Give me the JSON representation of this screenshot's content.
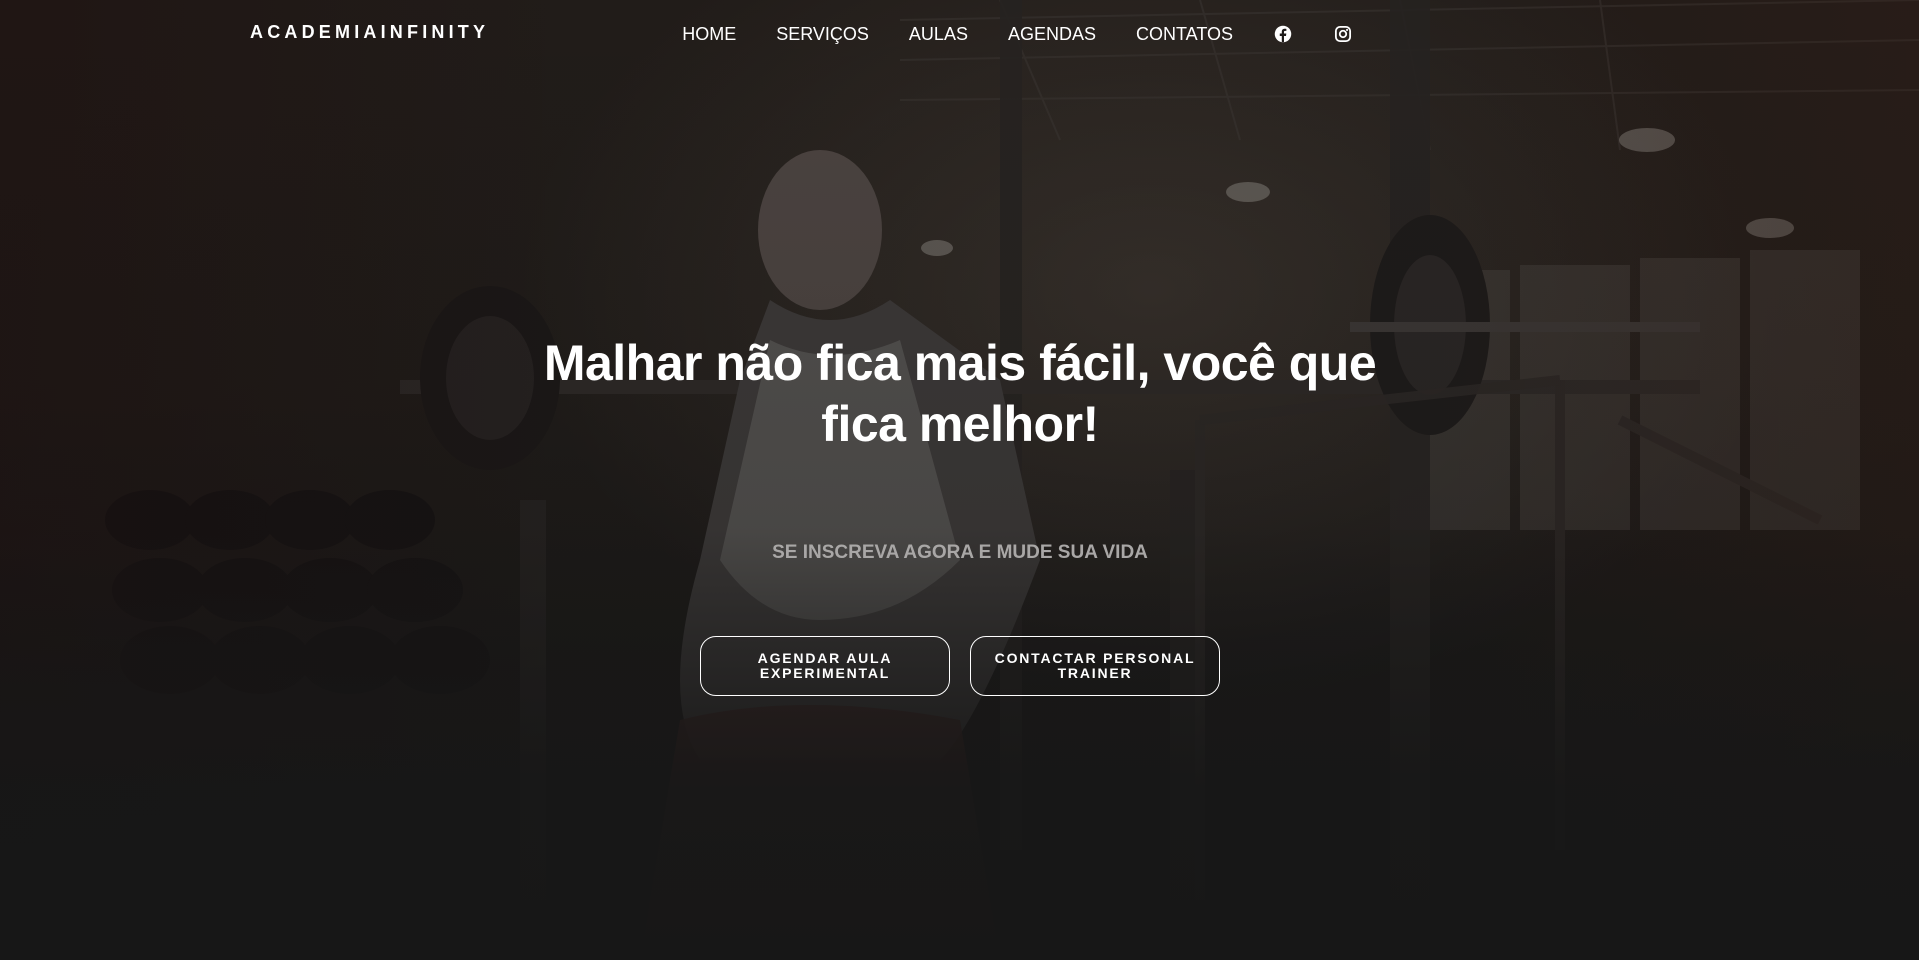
{
  "header": {
    "brand": "ACADEMIAINFINITY",
    "nav": [
      {
        "label": "HOME"
      },
      {
        "label": "SERVIÇOS"
      },
      {
        "label": "AULAS"
      },
      {
        "label": "AGENDAS"
      },
      {
        "label": "CONTATOS"
      }
    ],
    "social_icons": [
      "facebook-icon",
      "instagram-icon"
    ]
  },
  "hero": {
    "headline": "Malhar não fica mais fácil, você que fica melhor!",
    "subtitle": "SE INSCREVA AGORA E MUDE SUA VIDA",
    "buttons": [
      {
        "label": "AGENDAR AULA EXPERIMENTAL"
      },
      {
        "label": "CONTACTAR PERSONAL TRAINER"
      }
    ]
  },
  "colors": {
    "background": "#171717",
    "text": "#ffffff",
    "subtitle": "#a9a7a6",
    "button_border": "#ffffff"
  }
}
